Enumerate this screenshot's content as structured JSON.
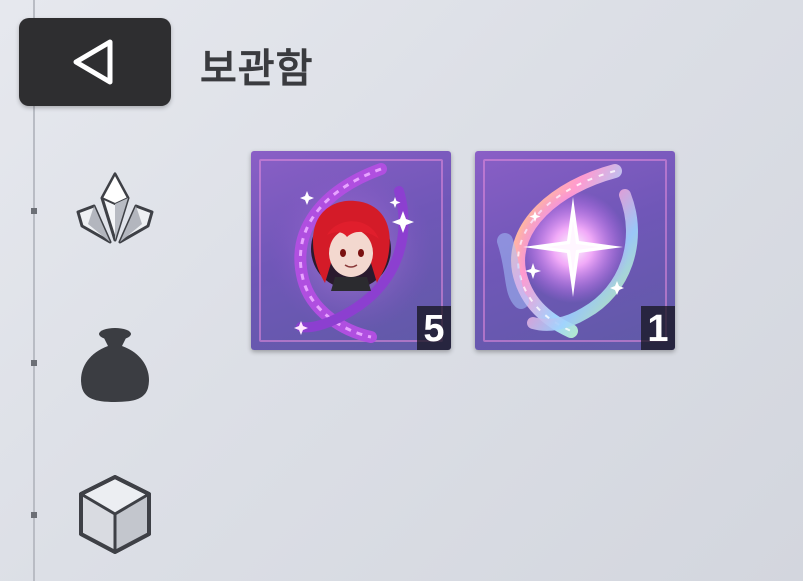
{
  "header": {
    "title": "보관함"
  },
  "sidebar": {
    "items": [
      {
        "icon": "crystal-icon"
      },
      {
        "icon": "pouch-icon"
      },
      {
        "icon": "cube-icon"
      }
    ]
  },
  "inventory": {
    "items": [
      {
        "icon": "character-fragment-icon",
        "count": "5"
      },
      {
        "icon": "star-fragment-icon",
        "count": "1"
      }
    ]
  },
  "colors": {
    "back_button_bg": "#2e2e30",
    "slot_purple": "#7a5cc0",
    "title_text": "#3a3b3f"
  }
}
